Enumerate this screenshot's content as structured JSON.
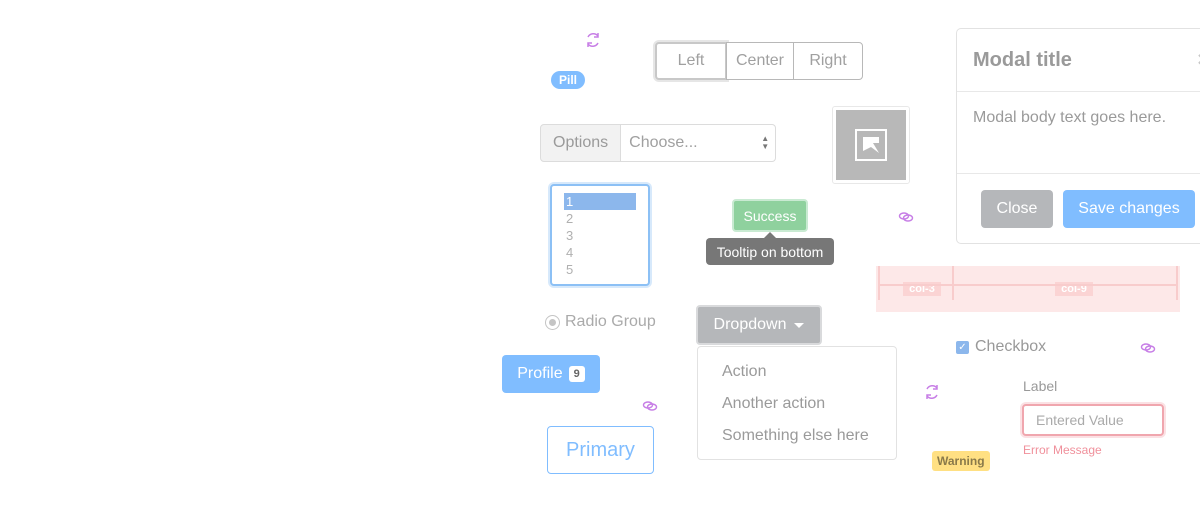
{
  "pill": {
    "label": "Pill"
  },
  "button_group": {
    "left": "Left",
    "center": "Center",
    "right": "Right"
  },
  "input_group": {
    "prepend": "Options",
    "select_value": "Choose..."
  },
  "multiselect": {
    "options": [
      "1",
      "2",
      "3",
      "4",
      "5"
    ],
    "selected": "1"
  },
  "tooltip_demo": {
    "button_label": "Success",
    "tooltip_text": "Tooltip on bottom"
  },
  "modal": {
    "title": "Modal title",
    "close_symbol": "×",
    "body": "Modal body text goes here.",
    "close_button": "Close",
    "save_button": "Save changes"
  },
  "grid": {
    "col_small": "col-3",
    "col_large": "col-9"
  },
  "radio": {
    "label": "Radio Group"
  },
  "dropdown": {
    "button_label": "Dropdown",
    "items": [
      "Action",
      "Another action",
      "Something else here"
    ]
  },
  "checkbox": {
    "label": "Checkbox",
    "checked": true
  },
  "profile_button": {
    "label": "Profile",
    "badge": "9"
  },
  "outline_button": {
    "label": "Primary"
  },
  "form": {
    "label": "Label",
    "value": "Entered Value",
    "error": "Error Message"
  },
  "warning_badge": {
    "label": "Warning"
  },
  "colors": {
    "primary": "#80bdff",
    "secondary": "#b5b7ba",
    "success": "#8fd19e",
    "warning": "#ffe083",
    "danger": "#f0909b",
    "icon_accent": "#c77ee6"
  },
  "icons": [
    "sync-icon",
    "link-icon",
    "image-icon",
    "close-icon",
    "caret-down-icon",
    "check-icon"
  ]
}
